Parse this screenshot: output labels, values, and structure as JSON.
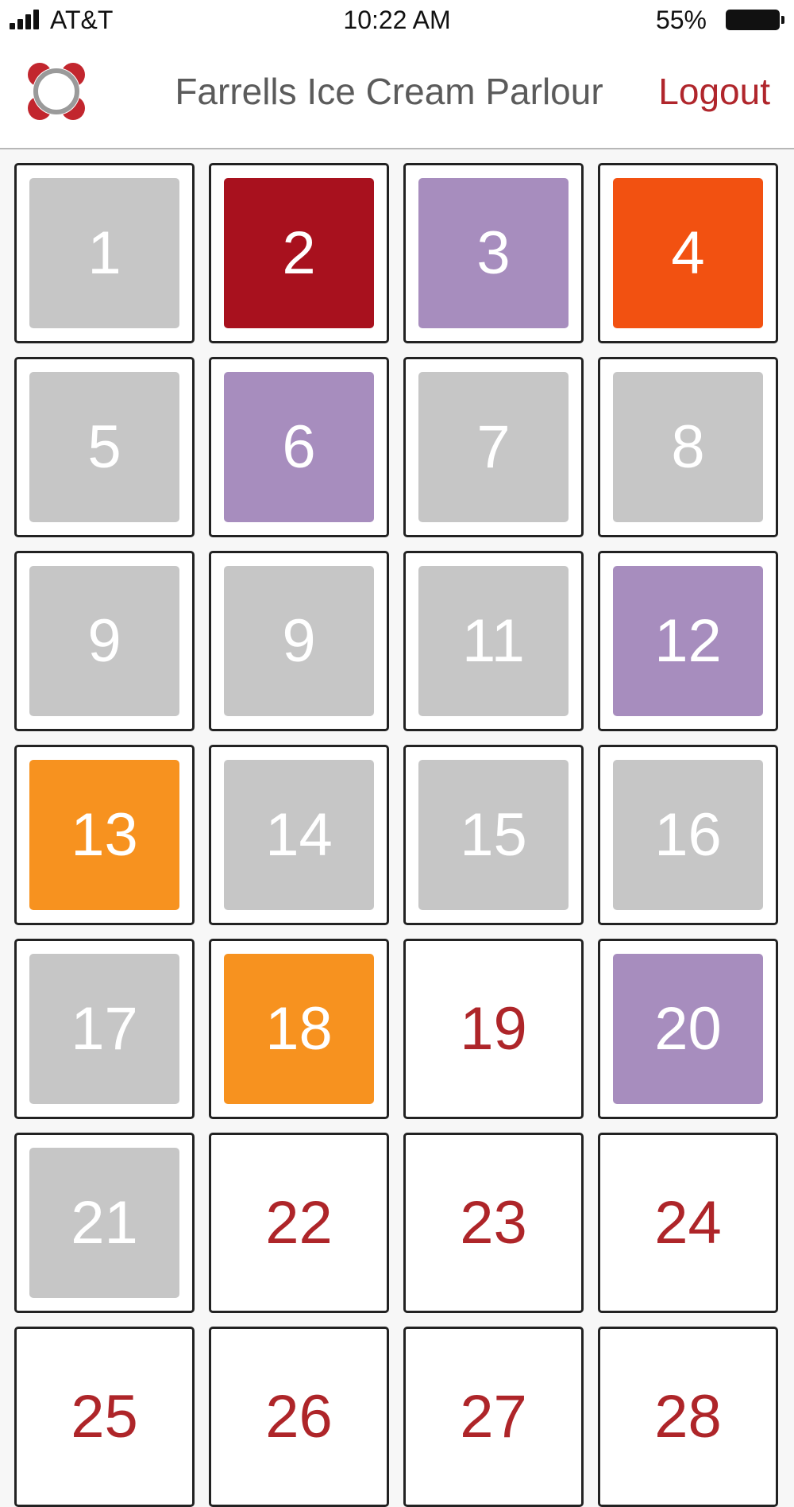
{
  "status_bar": {
    "carrier": "AT&T",
    "time": "10:22 AM",
    "battery_percent": "55%",
    "battery_level": 0.55,
    "signal_icon": "signal-bars-icon",
    "battery_icon": "battery-icon"
  },
  "header": {
    "logo_icon": "ring-logo-icon",
    "title": "Farrells Ice Cream Parlour",
    "logout_label": "Logout"
  },
  "colors": {
    "grey": "#c6c6c6",
    "red": "#a8111e",
    "purple": "#a78dbe",
    "orange_red": "#f25111",
    "orange": "#f7921f",
    "text_accent": "#ae2529"
  },
  "tiles": [
    {
      "label": "1",
      "color": "#c6c6c6"
    },
    {
      "label": "2",
      "color": "#a8111e"
    },
    {
      "label": "3",
      "color": "#a78dbe"
    },
    {
      "label": "4",
      "color": "#f25111"
    },
    {
      "label": "5",
      "color": "#c6c6c6"
    },
    {
      "label": "6",
      "color": "#a78dbe"
    },
    {
      "label": "7",
      "color": "#c6c6c6"
    },
    {
      "label": "8",
      "color": "#c6c6c6"
    },
    {
      "label": "9",
      "color": "#c6c6c6"
    },
    {
      "label": "9",
      "color": "#c6c6c6"
    },
    {
      "label": "11",
      "color": "#c6c6c6"
    },
    {
      "label": "12",
      "color": "#a78dbe"
    },
    {
      "label": "13",
      "color": "#f7921f"
    },
    {
      "label": "14",
      "color": "#c6c6c6"
    },
    {
      "label": "15",
      "color": "#c6c6c6"
    },
    {
      "label": "16",
      "color": "#c6c6c6"
    },
    {
      "label": "17",
      "color": "#c6c6c6"
    },
    {
      "label": "18",
      "color": "#f7921f"
    },
    {
      "label": "19",
      "color": null
    },
    {
      "label": "20",
      "color": "#a78dbe"
    },
    {
      "label": "21",
      "color": "#c6c6c6"
    },
    {
      "label": "22",
      "color": null
    },
    {
      "label": "23",
      "color": null
    },
    {
      "label": "24",
      "color": null
    },
    {
      "label": "25",
      "color": null
    },
    {
      "label": "26",
      "color": null
    },
    {
      "label": "27",
      "color": null
    },
    {
      "label": "28",
      "color": null
    }
  ]
}
